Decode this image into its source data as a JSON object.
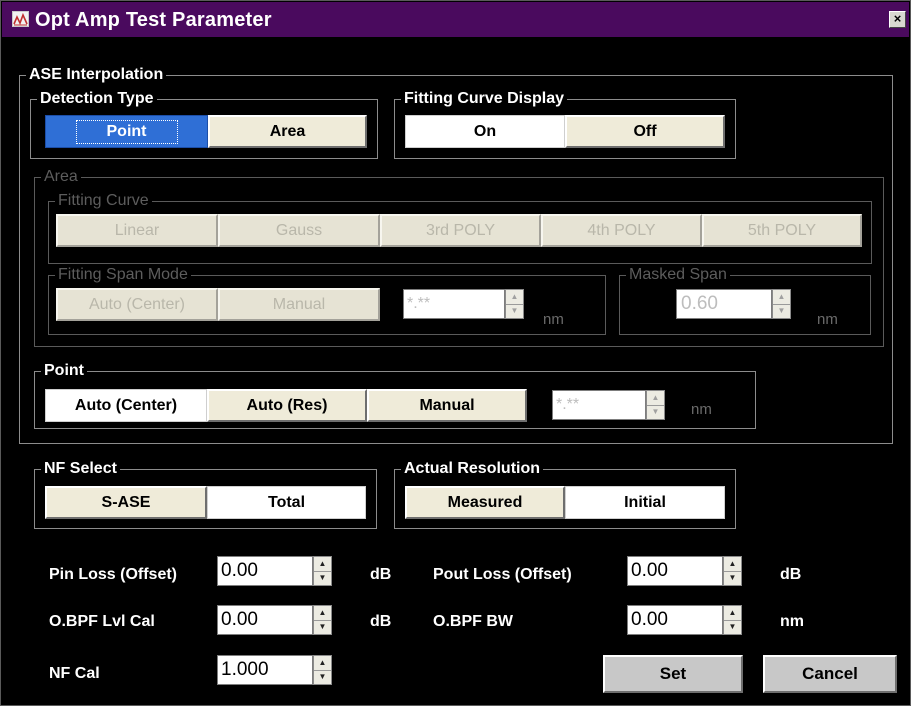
{
  "window": {
    "title": "Opt Amp Test Parameter",
    "close_label": "×"
  },
  "ase": {
    "legend": "ASE Interpolation",
    "detection": {
      "legend": "Detection Type",
      "point_label": "Point",
      "area_label": "Area"
    },
    "fitting_display": {
      "legend": "Fitting Curve Display",
      "on_label": "On",
      "off_label": "Off"
    },
    "area": {
      "legend": "Area",
      "fitting_curve": {
        "legend": "Fitting Curve",
        "options": [
          "Linear",
          "Gauss",
          "3rd POLY",
          "4th POLY",
          "5th POLY"
        ]
      },
      "span_mode": {
        "legend": "Fitting Span Mode",
        "auto_label": "Auto (Center)",
        "manual_label": "Manual",
        "value": "*.**",
        "unit": "nm"
      },
      "masked_span": {
        "legend": "Masked Span",
        "value": "0.60",
        "unit": "nm"
      }
    },
    "point": {
      "legend": "Point",
      "auto_center_label": "Auto (Center)",
      "auto_res_label": "Auto (Res)",
      "manual_label": "Manual",
      "value": "*.**",
      "unit": "nm"
    }
  },
  "nf_select": {
    "legend": "NF Select",
    "sase_label": "S-ASE",
    "total_label": "Total"
  },
  "actual_res": {
    "legend": "Actual Resolution",
    "measured_label": "Measured",
    "initial_label": "Initial"
  },
  "params": {
    "pin_loss": {
      "label": "Pin Loss (Offset)",
      "value": "0.00",
      "unit": "dB"
    },
    "pout_loss": {
      "label": "Pout Loss (Offset)",
      "value": "0.00",
      "unit": "dB"
    },
    "obpf_lvl": {
      "label": "O.BPF Lvl Cal",
      "value": "0.00",
      "unit": "dB"
    },
    "obpf_bw": {
      "label": "O.BPF BW",
      "value": "0.00",
      "unit": "nm"
    },
    "nf_cal": {
      "label": "NF Cal",
      "value": "1.000"
    }
  },
  "actions": {
    "set_label": "Set",
    "cancel_label": "Cancel"
  },
  "colors": {
    "title_bar": "#4a0a5e",
    "background": "#000000",
    "selected_blue": "#2f6fd6",
    "button_face": "#efebd9"
  }
}
